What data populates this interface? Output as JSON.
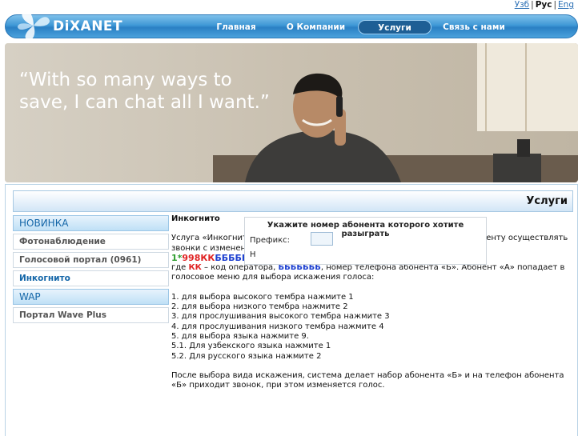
{
  "lang": {
    "uz": "Узб",
    "ru": "Рус",
    "en": "Eng",
    "sep": "|"
  },
  "logo": {
    "text": "DiXANET"
  },
  "nav": {
    "items": [
      "Главная",
      "О Компании",
      "Услуги",
      "Связь с нами"
    ],
    "active": 2
  },
  "banner": {
    "quote": "“With so many ways to save, I can chat all I want.”"
  },
  "page": {
    "title": "Услуги"
  },
  "sidebar": {
    "groups": [
      {
        "heading": "НОВИНКА",
        "items": [
          "Фотонаблюдение",
          "Голосовой портал (0961)",
          "Инкогнито"
        ]
      },
      {
        "heading": "WAP",
        "items": [
          "Портал Wave Plus"
        ]
      }
    ],
    "active_item": "Инкогнито"
  },
  "content": {
    "heading": "Инкогнито",
    "intro": "Услуга «Инкогнито» является развлекательной услугой и позволяет абоненту осуществлять звонки с изменением голоса. Абонент «А» набирает номер в формате:",
    "format": {
      "p1": "1*",
      "p2": "998КК",
      "p3": "БББББББ",
      "p4": ","
    },
    "explain": {
      "w1": "где ",
      "kk": "КК",
      "w2": " – код оператора, ",
      "bb": "БББББББ",
      "w3": ", номер телефона абонента «Б». Абонент «А» попадает в голосовое меню для выбора искажения голоса:"
    },
    "steps": [
      "1. для выбора высокого тембра нажмите 1",
      "2. для выбора низкого тембра нажмите 2",
      "3. для прослушивания высокого тембра нажмите 3",
      "4. для прослушивания низкого тембра нажмите 4",
      "5. для выбора языка нажмите 9.",
      "5.1. Для узбекского языка нажмите 1",
      "5.2. Для русского языка нажмите 2"
    ],
    "after": "После выбора вида искажения, система делает набор абонента «Б» и на телефон абонента «Б» приходит звонок, при этом изменяется голос."
  },
  "form": {
    "title": "Укажите номер абонента которого хотите разыграть",
    "prefix_label": "Префикс:",
    "prefix_value": "",
    "row2_label": "Н"
  },
  "colors": {
    "nav": "#3f98d6",
    "accent": "#1466a8",
    "green": "#2d9d2d",
    "red": "#e02424",
    "blue": "#1c3fd0"
  }
}
